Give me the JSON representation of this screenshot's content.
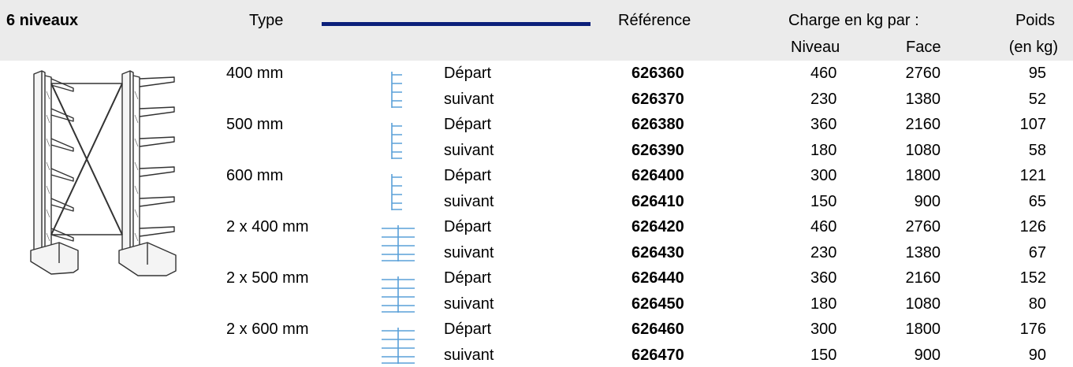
{
  "header": {
    "title": "6 niveaux",
    "type_label": "Type",
    "reference_label": "Référence",
    "charge_label": "Charge en kg par :",
    "niveau_label": "Niveau",
    "face_label": "Face",
    "poids_label": "Poids",
    "poids_unit_label": "(en kg)",
    "accent_line_color": "#0b1f7a"
  },
  "icons": {
    "illustration": "cantilever-rack-illustration",
    "single_sided": "single-sided-rack-icon",
    "double_sided": "double-sided-rack-icon",
    "icon_color": "#5aa0d8"
  },
  "groups": [
    {
      "type": "400 mm",
      "rows": [
        {
          "kind": "Départ",
          "ref": "626360",
          "niveau": "460",
          "face": "2760",
          "poids": "95"
        },
        {
          "kind": "suivant",
          "ref": "626370",
          "niveau": "230",
          "face": "1380",
          "poids": "52"
        }
      ]
    },
    {
      "type": "500 mm",
      "rows": [
        {
          "kind": "Départ",
          "ref": "626380",
          "niveau": "360",
          "face": "2160",
          "poids": "107"
        },
        {
          "kind": "suivant",
          "ref": "626390",
          "niveau": "180",
          "face": "1080",
          "poids": "58"
        }
      ]
    },
    {
      "type": "600 mm",
      "rows": [
        {
          "kind": "Départ",
          "ref": "626400",
          "niveau": "300",
          "face": "1800",
          "poids": "121"
        },
        {
          "kind": "suivant",
          "ref": "626410",
          "niveau": "150",
          "face": "900",
          "poids": "65"
        }
      ]
    },
    {
      "type": "2 x 400 mm",
      "rows": [
        {
          "kind": "Départ",
          "ref": "626420",
          "niveau": "460",
          "face": "2760",
          "poids": "126"
        },
        {
          "kind": "suivant",
          "ref": "626430",
          "niveau": "230",
          "face": "1380",
          "poids": "67"
        }
      ]
    },
    {
      "type": "2 x 500 mm",
      "rows": [
        {
          "kind": "Départ",
          "ref": "626440",
          "niveau": "360",
          "face": "2160",
          "poids": "152"
        },
        {
          "kind": "suivant",
          "ref": "626450",
          "niveau": "180",
          "face": "1080",
          "poids": "80"
        }
      ]
    },
    {
      "type": "2 x 600 mm",
      "rows": [
        {
          "kind": "Départ",
          "ref": "626460",
          "niveau": "300",
          "face": "1800",
          "poids": "176"
        },
        {
          "kind": "suivant",
          "ref": "626470",
          "niveau": "150",
          "face": "900",
          "poids": "90"
        }
      ]
    }
  ]
}
